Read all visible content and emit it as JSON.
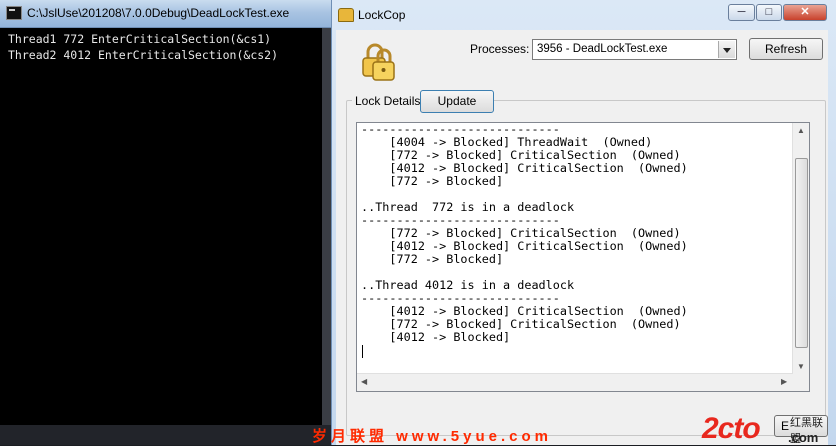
{
  "console": {
    "title": "C:\\JslUse\\201208\\7.0.0Debug\\DeadLockTest.exe",
    "lines": [
      "Thread1 772 EnterCriticalSection(&cs1)",
      "Thread2 4012 EnterCriticalSection(&cs2)"
    ]
  },
  "lockcop": {
    "title": "LockCop",
    "processes_label": "Processes:",
    "process_selected": "3956 - DeadLockTest.exe",
    "refresh_label": "Refresh",
    "group_label": "Lock Details",
    "update_label": "Update",
    "output_lines": [
      "----------------------------",
      "    [4004 -> Blocked] ThreadWait  (Owned)",
      "    [772 -> Blocked] CriticalSection  (Owned)",
      "    [4012 -> Blocked] CriticalSection  (Owned)",
      "    [772 -> Blocked]",
      "",
      "..Thread  772 is in a deadlock",
      "----------------------------",
      "    [772 -> Blocked] CriticalSection  (Owned)",
      "    [4012 -> Blocked] CriticalSection  (Owned)",
      "    [772 -> Blocked]",
      "",
      "..Thread 4012 is in a deadlock",
      "----------------------------",
      "    [4012 -> Blocked] CriticalSection  (Owned)",
      "    [772 -> Blocked] CriticalSection  (Owned)",
      "    [4012 -> Blocked]"
    ],
    "exit_label": "E",
    "watermark_main": "2cto",
    "watermark_dotcom": ".com",
    "watermark_cn": "红黑联盟"
  },
  "caption_buttons": {
    "minimize": "─",
    "maximize": "□",
    "close": "✕"
  },
  "footer_text": "岁月联盟 www.5yue.com",
  "colors": {
    "console_bg": "#000000",
    "console_text": "#e8e8e8",
    "titlebar": "#c3d7ee",
    "watermark_red": "#e8281e"
  },
  "icons": [
    "console-app-icon",
    "lock-app-icon",
    "padlocks-icon",
    "dropdown-arrow-icon",
    "scroll-up-icon",
    "scroll-down-icon",
    "scroll-left-icon",
    "scroll-right-icon"
  ]
}
